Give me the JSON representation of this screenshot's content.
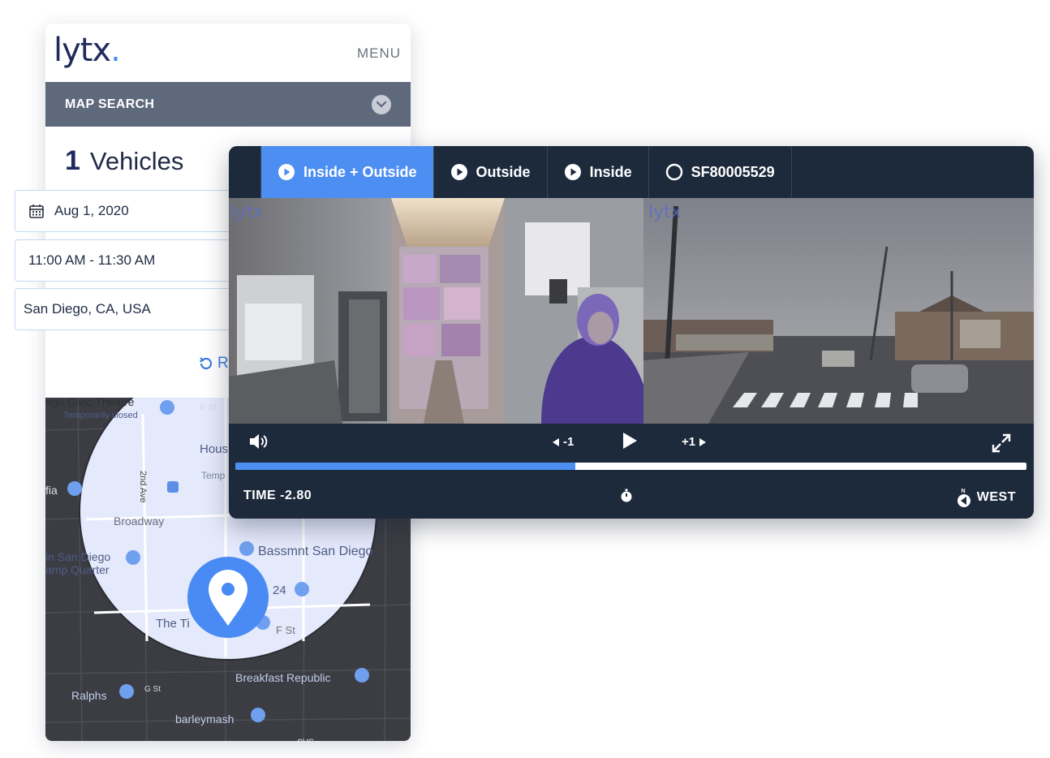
{
  "mobile": {
    "logo": "lytx",
    "menu_label": "MENU",
    "map_search_label": "MAP SEARCH",
    "vehicle_count": "1",
    "vehicles_label": "Vehicles",
    "reset_label": "R"
  },
  "filters": {
    "date": "Aug 1, 2020",
    "time_range": "11:00 AM - 11:30 AM",
    "location": "San Diego, CA, USA"
  },
  "map": {
    "labels": {
      "civic_theatre": "ego Civic Theatre",
      "temporarily_closed": "Temporarily closed",
      "b_st": "B St",
      "house": "Hous",
      "temp": "Temp",
      "second_ave": "2nd Ave",
      "fia": "fia",
      "broadway": "Broadway",
      "bassmnt": "Bassmnt San Diego",
      "san_diego_1": "in San Diego",
      "san_diego_2": "amp Quarter",
      "num_24": "24",
      "the_tip": "The Ti",
      "f_st": "F St",
      "breakfast": "Breakfast Republic",
      "ralphs": "Ralphs",
      "g_st": "G St",
      "barleymash": "barleymash",
      "cvs": "cvs"
    },
    "accent_color": "#4a8af4"
  },
  "player": {
    "tabs": [
      {
        "label": "Inside + Outside",
        "active": true,
        "icon": "play-circle-icon"
      },
      {
        "label": "Outside",
        "active": false,
        "icon": "play-circle-icon"
      },
      {
        "label": "Inside",
        "active": false,
        "icon": "play-circle-icon"
      },
      {
        "label": "SF80005529",
        "active": false,
        "icon": "empty-circle-icon"
      }
    ],
    "watermark": "lytx",
    "skip_back_label": "-1",
    "skip_forward_label": "+1",
    "progress": 0.43,
    "time_label": "TIME -2.80",
    "direction_label": "WEST",
    "compass_letter": "N",
    "accent_color": "#4d8ef2",
    "background_color": "#1d2a3c"
  }
}
